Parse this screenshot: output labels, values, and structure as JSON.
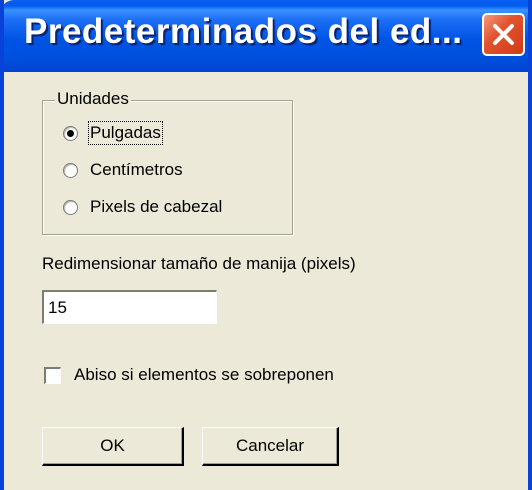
{
  "window": {
    "title": "Predeterminados del ed...",
    "close_icon": "close-icon"
  },
  "units_group": {
    "legend": "Unidades",
    "options": [
      {
        "label": "Pulgadas",
        "selected": true
      },
      {
        "label": "Centímetros",
        "selected": false
      },
      {
        "label": "Pixels de cabezal",
        "selected": false
      }
    ]
  },
  "handle_size": {
    "label": "Redimensionar tamaño de manija (pixels)",
    "value": "15"
  },
  "overlap_warning": {
    "label": "Abiso si elementos se sobreponen",
    "checked": false
  },
  "buttons": {
    "ok_label": "OK",
    "cancel_label": "Cancelar"
  },
  "colors": {
    "titlebar": "#0054e3",
    "dialog_bg": "#ece9d8",
    "close_button": "#e2542f"
  }
}
